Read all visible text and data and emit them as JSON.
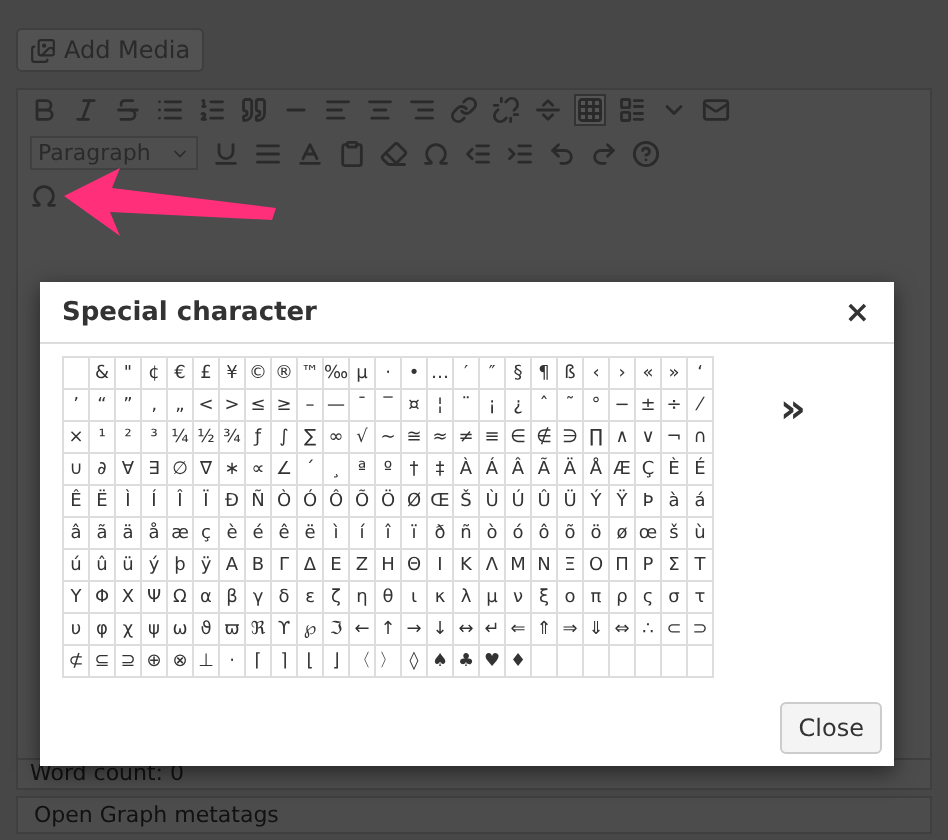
{
  "editor": {
    "add_media": "Add Media",
    "format_select": "Paragraph",
    "word_count": "Word count: 0",
    "meta_box_title": "Open Graph metatags"
  },
  "dialog": {
    "title": "Special character",
    "close_symbol": "×",
    "first_cell_blank": true,
    "characters": [
      [
        "&",
        "\"",
        "¢",
        "€",
        "£",
        "¥",
        "©",
        "®",
        "™",
        "‰",
        "µ",
        "·",
        "•",
        "…",
        "′",
        "″",
        "§",
        "¶",
        "ß",
        "‹",
        "›",
        "«",
        "»",
        "‘"
      ],
      [
        "’",
        "“",
        "”",
        "‚",
        "„",
        "<",
        ">",
        "≤",
        "≥",
        "–",
        "—",
        "¯",
        "‾",
        "¤",
        "¦",
        "¨",
        "¡",
        "¿",
        "ˆ",
        "˜",
        "°",
        "−",
        "±",
        "÷",
        "⁄"
      ],
      [
        "×",
        "¹",
        "²",
        "³",
        "¼",
        "½",
        "¾",
        "ƒ",
        "∫",
        "∑",
        "∞",
        "√",
        "∼",
        "≅",
        "≈",
        "≠",
        "≡",
        "∈",
        "∉",
        "∋",
        "∏",
        "∧",
        "∨",
        "¬",
        "∩"
      ],
      [
        "∪",
        "∂",
        "∀",
        "∃",
        "∅",
        "∇",
        "∗",
        "∝",
        "∠",
        "´",
        "¸",
        "ª",
        "º",
        "†",
        "‡",
        "À",
        "Á",
        "Â",
        "Ã",
        "Ä",
        "Å",
        "Æ",
        "Ç",
        "È",
        "É"
      ],
      [
        "Ê",
        "Ë",
        "Ì",
        "Í",
        "Î",
        "Ï",
        "Ð",
        "Ñ",
        "Ò",
        "Ó",
        "Ô",
        "Õ",
        "Ö",
        "Ø",
        "Œ",
        "Š",
        "Ù",
        "Ú",
        "Û",
        "Ü",
        "Ý",
        "Ÿ",
        "Þ",
        "à",
        "á"
      ],
      [
        "â",
        "ã",
        "ä",
        "å",
        "æ",
        "ç",
        "è",
        "é",
        "ê",
        "ë",
        "ì",
        "í",
        "î",
        "ï",
        "ð",
        "ñ",
        "ò",
        "ó",
        "ô",
        "õ",
        "ö",
        "ø",
        "œ",
        "š",
        "ù"
      ],
      [
        "ú",
        "û",
        "ü",
        "ý",
        "þ",
        "ÿ",
        "Α",
        "Β",
        "Γ",
        "Δ",
        "Ε",
        "Ζ",
        "Η",
        "Θ",
        "Ι",
        "Κ",
        "Λ",
        "Μ",
        "Ν",
        "Ξ",
        "Ο",
        "Π",
        "Ρ",
        "Σ",
        "Τ"
      ],
      [
        "Υ",
        "Φ",
        "Χ",
        "Ψ",
        "Ω",
        "α",
        "β",
        "γ",
        "δ",
        "ε",
        "ζ",
        "η",
        "θ",
        "ι",
        "κ",
        "λ",
        "μ",
        "ν",
        "ξ",
        "ο",
        "π",
        "ρ",
        "ς",
        "σ",
        "τ"
      ],
      [
        "υ",
        "φ",
        "χ",
        "ψ",
        "ω",
        "ϑ",
        "ϖ",
        "ℜ",
        "ϒ",
        "℘",
        "ℑ",
        "←",
        "↑",
        "→",
        "↓",
        "↔",
        "↵",
        "⇐",
        "⇑",
        "⇒",
        "⇓",
        "⇔",
        "∴",
        "⊂",
        "⊃"
      ],
      [
        "⊄",
        "⊆",
        "⊇",
        "⊕",
        "⊗",
        "⊥",
        "⋅",
        "⌈",
        "⌉",
        "⌊",
        "⌋",
        "〈",
        "〉",
        "◊",
        "♠",
        "♣",
        "♥",
        "♦"
      ]
    ],
    "preview": "»",
    "close_button": "Close"
  }
}
